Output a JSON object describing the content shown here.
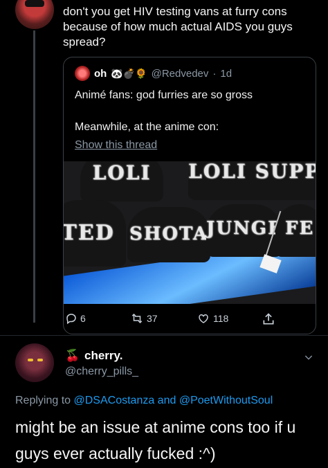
{
  "top_tweet": {
    "text": "don't you get HIV testing vans at furry cons because of how much actual AIDS you guys spread?"
  },
  "quoted_tweet": {
    "display_name": "oh",
    "emojis": "🐼💣🌻",
    "handle": "@Redvedev",
    "separator": "·",
    "time": "1d",
    "line1": "Animé fans: god furries are so gross",
    "line2": "Meanwhile, at the anime con:",
    "show_thread": "Show this thread",
    "photo_labels": [
      "LOLI",
      "LOLI SUPPO",
      "TED",
      "SHOTA",
      "JUNGE",
      "FE"
    ],
    "reply_count": "6",
    "retweet_count": "37",
    "like_count": "118"
  },
  "reply": {
    "name_emoji": "🍒",
    "display_name": "cherry.",
    "handle": "@cherry_pills_",
    "replying_prefix": "Replying to",
    "replying_targets": "@DSACostanza and @PoetWithoutSoul",
    "body": "might be an issue at anime cons too if u guys ever actually fucked :^)"
  },
  "colors": {
    "background": "#000000",
    "muted": "#8b98a5",
    "link": "#1d9bf0",
    "border": "#3b4046"
  },
  "icons": [
    "reply-icon",
    "retweet-icon",
    "like-icon",
    "share-icon",
    "chevron-down-icon"
  ]
}
